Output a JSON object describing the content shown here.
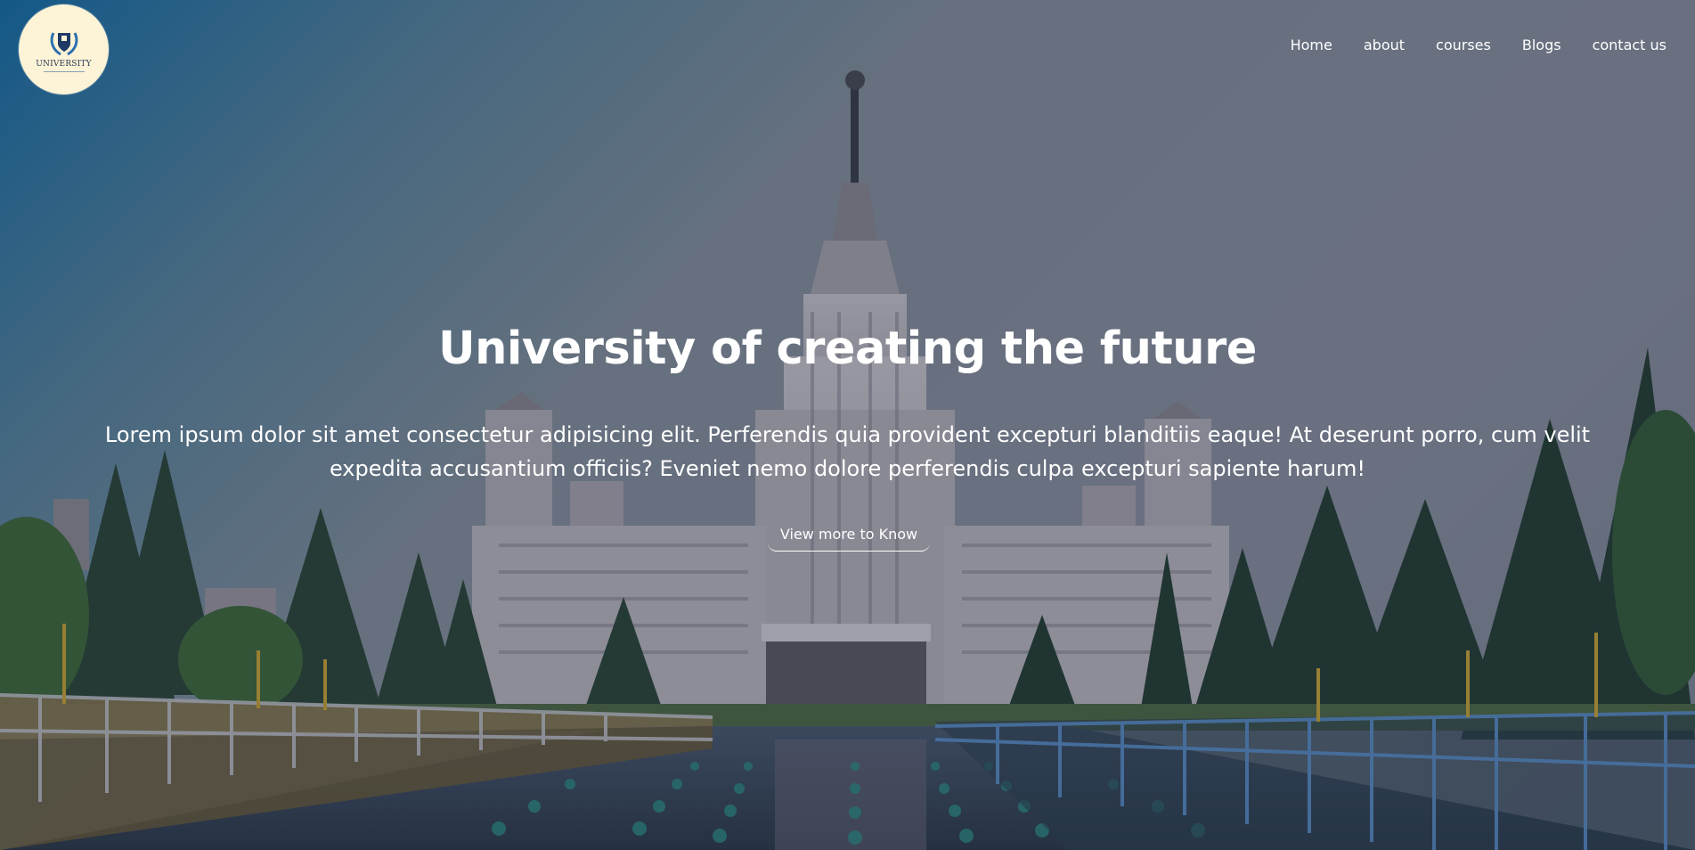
{
  "header": {
    "logo_text": "UNIVERSITY",
    "nav": [
      {
        "label": "Home"
      },
      {
        "label": "about"
      },
      {
        "label": "courses"
      },
      {
        "label": "Blogs"
      },
      {
        "label": "contact us"
      }
    ]
  },
  "hero": {
    "title": "University of creating the future",
    "description": "Lorem ipsum dolor sit amet consectetur adipisicing elit. Perferendis quia provident excepturi blanditiis eaque! At deserunt porro, cum velit expedita accusantium officiis? Eveniet nemo dolore perferendis culpa excepturi sapiente harum!",
    "cta_label": "View more to Know"
  },
  "colors": {
    "logo_bg": "#fdf3d6",
    "text": "#ffffff",
    "sky_accent": "#0e6eaa"
  }
}
